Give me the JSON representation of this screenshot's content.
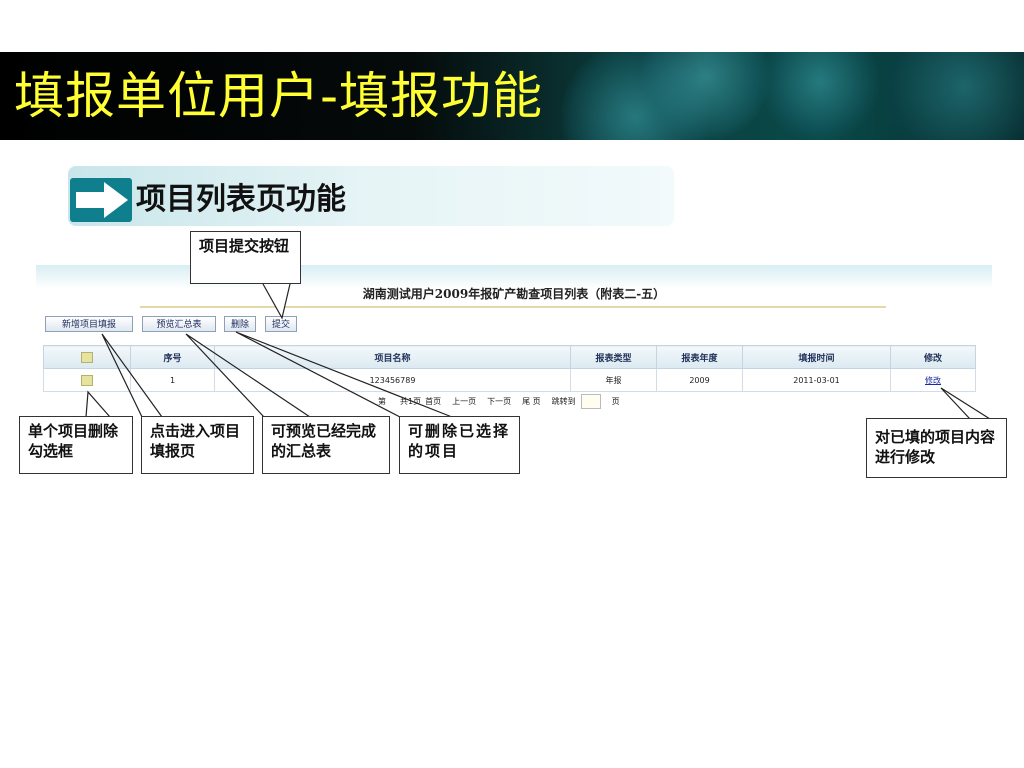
{
  "slide": {
    "title": "填报单位用户-填报功能",
    "section_title": "项目列表页功能",
    "accent_color": "#ffff33",
    "banner_color": "#0a4a4a",
    "arrow_icon": "arrow-right-icon"
  },
  "embed": {
    "report_title": "湖南测试用户2009年报矿产勘查项目列表（附表二-五）",
    "toolbar": {
      "new_label": "新增项目填报",
      "preview_label": "预览汇总表",
      "delete_label": "删除",
      "submit_label": "提交"
    },
    "table": {
      "headers": [
        "",
        "序号",
        "项目名称",
        "报表类型",
        "报表年度",
        "填报时间",
        "修改"
      ],
      "rows": [
        {
          "index": "1",
          "name": "123456789",
          "type": "年报",
          "year": "2009",
          "time": "2011-03-01",
          "action": "修改"
        }
      ]
    },
    "pager": {
      "page_a": "第",
      "page_b": "共1页",
      "first": "首页",
      "prev": "上一页",
      "next": "下一页",
      "last": "尾 页",
      "jump": "跳转到",
      "unit": "页"
    }
  },
  "callouts": {
    "submit": "项目提交按钮",
    "checkbox": "单个项目删除勾选框",
    "enter": "点击进入项目填报页",
    "preview": "可预览已经完成的汇总表",
    "delete": "可删除已选择的项目",
    "modify": "对已填的项目内容进行修改"
  }
}
